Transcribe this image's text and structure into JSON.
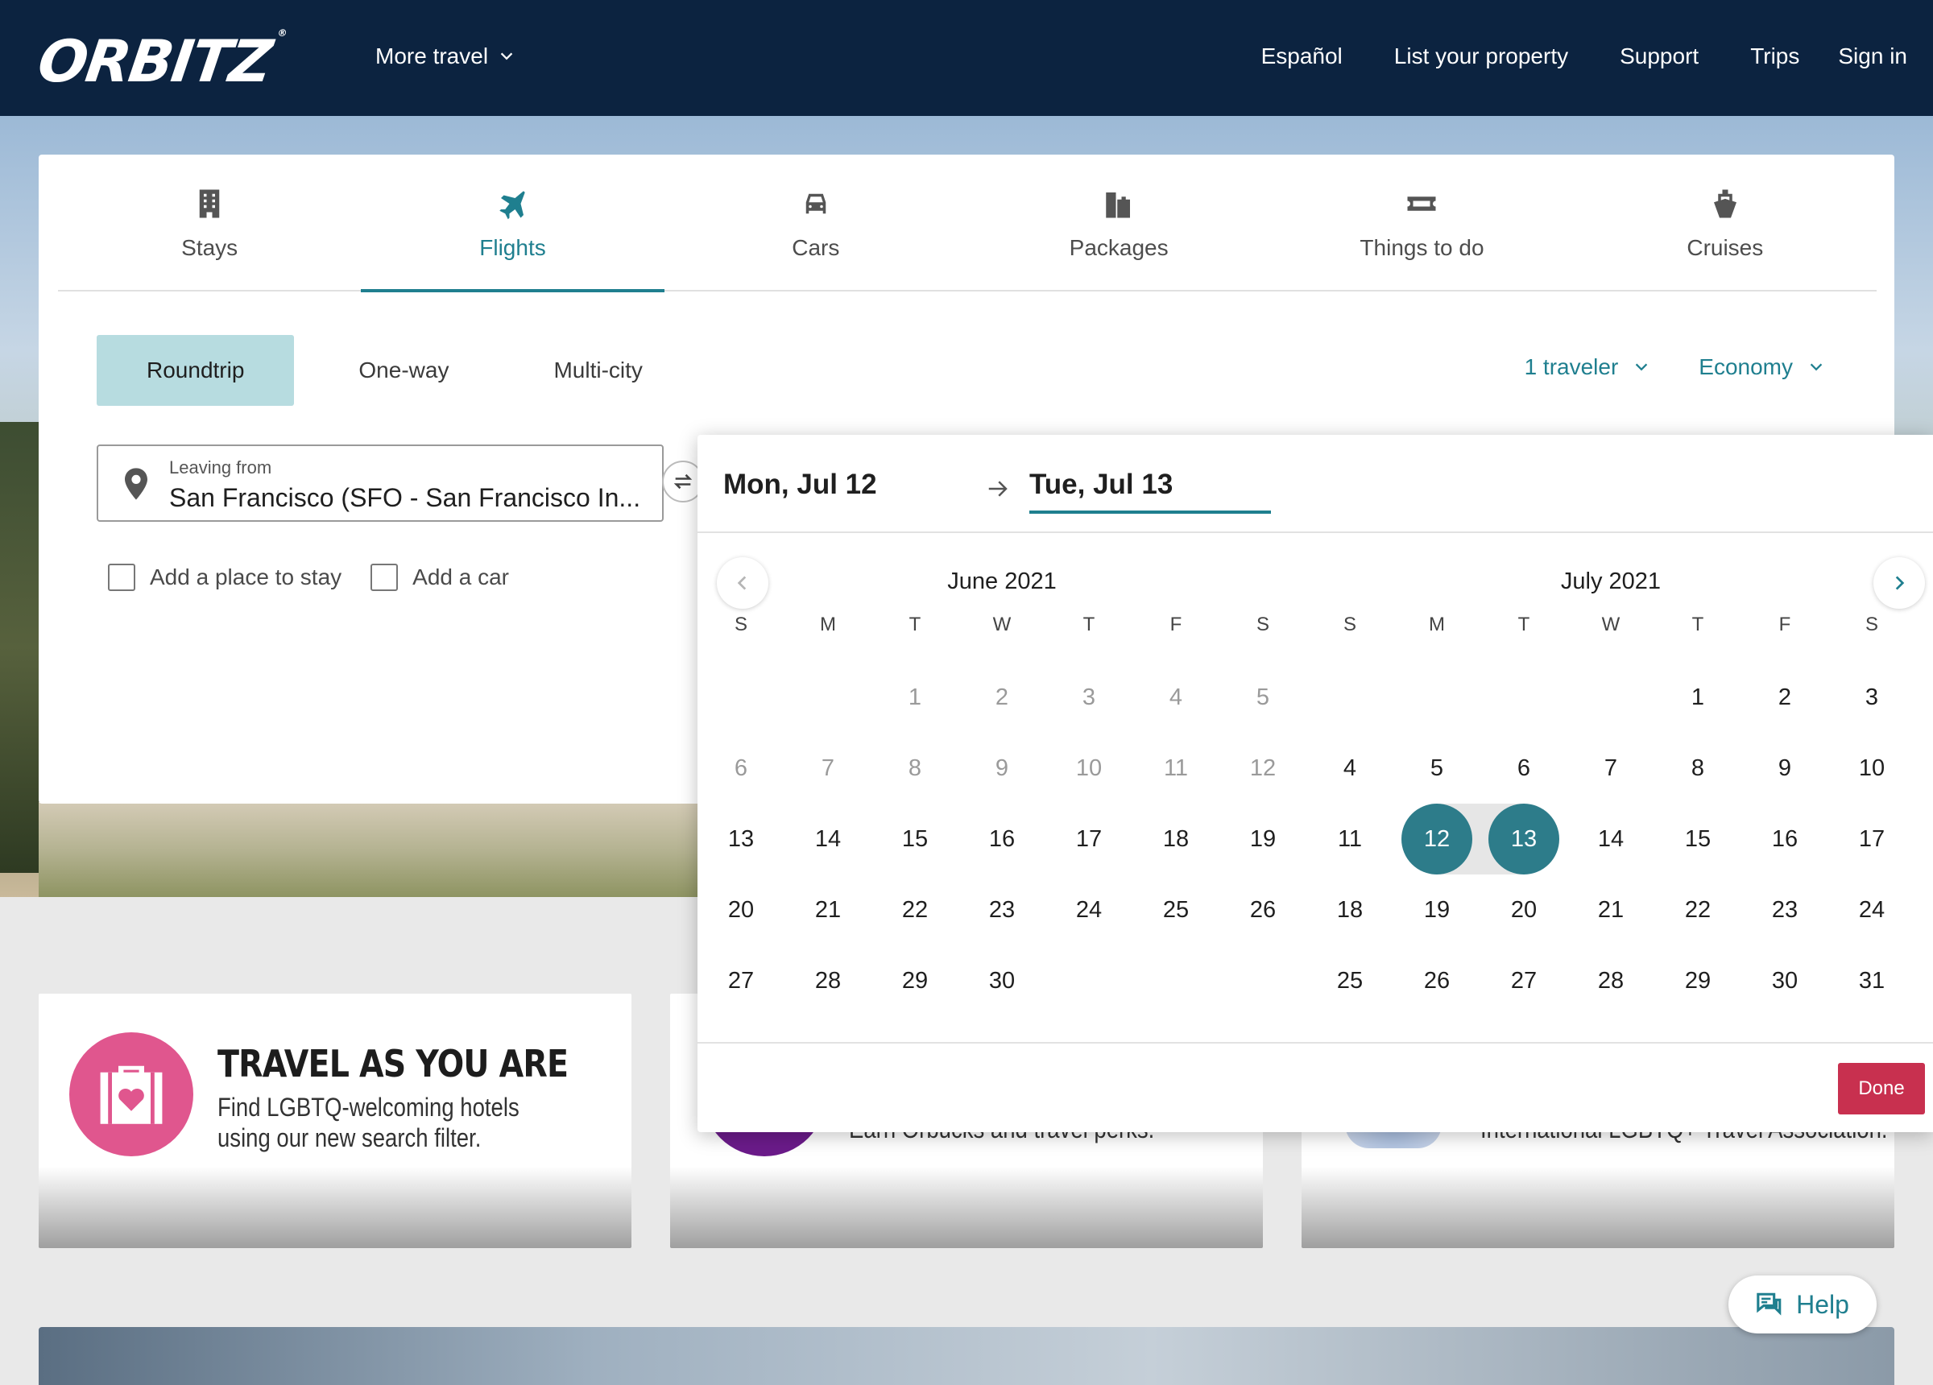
{
  "header": {
    "logo": "ORBITZ",
    "more_travel": "More travel",
    "nav": [
      "Español",
      "List your property",
      "Support",
      "Trips",
      "Sign in"
    ]
  },
  "tabs": [
    {
      "label": "Stays",
      "icon": "building-icon"
    },
    {
      "label": "Flights",
      "icon": "plane-icon",
      "active": true
    },
    {
      "label": "Cars",
      "icon": "car-icon"
    },
    {
      "label": "Packages",
      "icon": "packages-icon"
    },
    {
      "label": "Things to do",
      "icon": "ticket-icon"
    },
    {
      "label": "Cruises",
      "icon": "ship-icon"
    }
  ],
  "trip_types": [
    "Roundtrip",
    "One-way",
    "Multi-city"
  ],
  "travelers": "1 traveler",
  "cabin": "Economy",
  "leaving": {
    "label": "Leaving from",
    "value": "San Francisco (SFO - San Francisco In..."
  },
  "addons": [
    "Add a place to stay",
    "Add a car"
  ],
  "picker": {
    "depart": "Mon, Jul 12",
    "return": "Tue, Jul 13",
    "weekdays": [
      "S",
      "M",
      "T",
      "W",
      "T",
      "F",
      "S"
    ],
    "months": [
      {
        "title": "June 2021",
        "weeks": [
          [
            "",
            "",
            "1",
            "2",
            "3",
            "4",
            "5"
          ],
          [
            "6",
            "7",
            "8",
            "9",
            "10",
            "11",
            "12"
          ],
          [
            "13",
            "14",
            "15",
            "16",
            "17",
            "18",
            "19"
          ],
          [
            "20",
            "21",
            "22",
            "23",
            "24",
            "25",
            "26"
          ],
          [
            "27",
            "28",
            "29",
            "30",
            "",
            "",
            ""
          ]
        ],
        "past_through": 12
      },
      {
        "title": "July 2021",
        "weeks": [
          [
            "",
            "",
            "",
            "",
            "1",
            "2",
            "3"
          ],
          [
            "4",
            "5",
            "6",
            "7",
            "8",
            "9",
            "10"
          ],
          [
            "11",
            "12",
            "13",
            "14",
            "15",
            "16",
            "17"
          ],
          [
            "18",
            "19",
            "20",
            "21",
            "22",
            "23",
            "24"
          ],
          [
            "25",
            "26",
            "27",
            "28",
            "29",
            "30",
            "31"
          ]
        ],
        "selected": [
          "12",
          "13"
        ]
      }
    ],
    "done": "Done"
  },
  "promos": [
    {
      "title": "TRAVEL AS YOU ARE",
      "subtitle": "Find LGBTQ-welcoming hotels using our new search filter."
    },
    {
      "subtitle": "Earn Orbucks and travel perks."
    },
    {
      "subtitle": "International LGBTQ+ Travel Association."
    }
  ],
  "help": "Help",
  "colors": {
    "brand_navy": "#0c2340",
    "accent_teal": "#1f7f8f",
    "done_red": "#c8304f",
    "promo_pink": "#e0568e"
  }
}
